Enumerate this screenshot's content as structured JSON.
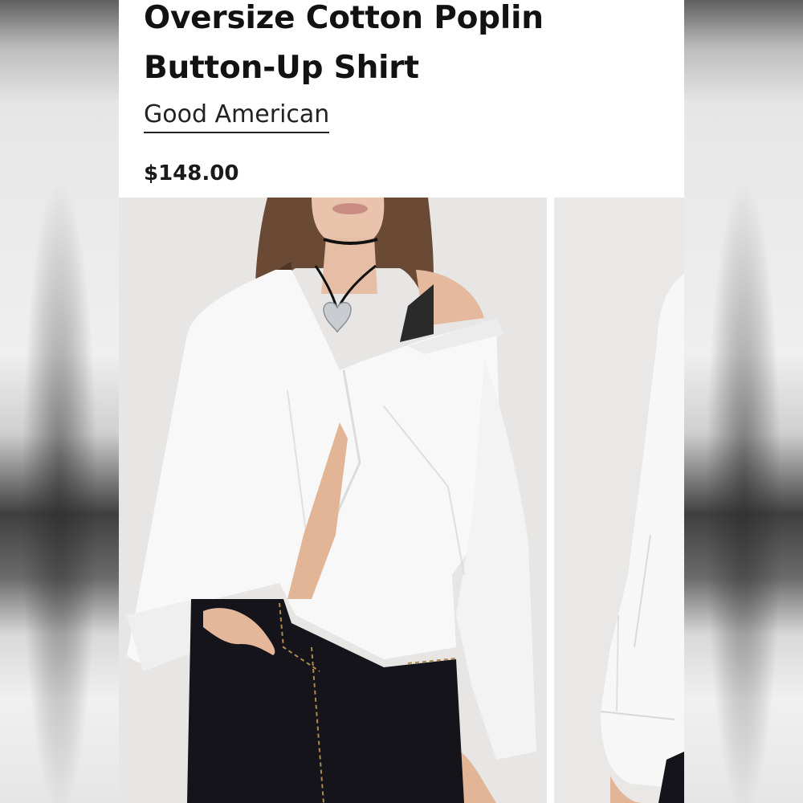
{
  "product": {
    "title": "Oversize Cotton Poplin Button-Up Shirt",
    "brand": "Good American",
    "price": "$148.00"
  },
  "gallery": {
    "images": [
      {
        "name": "model-front-shirt-photo"
      },
      {
        "name": "model-side-shirt-photo"
      }
    ]
  },
  "colors": {
    "text": "#121212",
    "background": "#ffffff",
    "photo_backdrop": "#e7e6e4",
    "shirt": "#f9f9f9",
    "jeans": "#14141a"
  }
}
